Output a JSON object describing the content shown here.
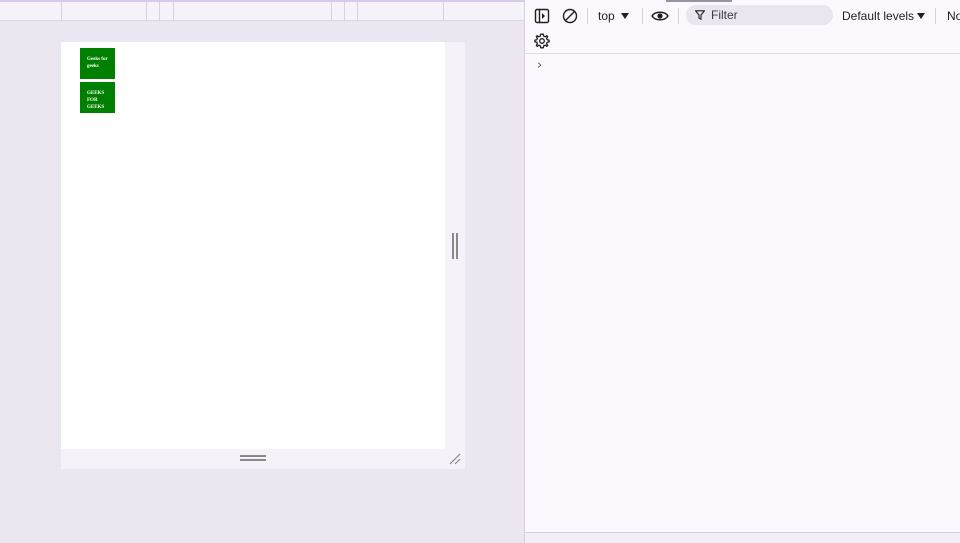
{
  "preview": {
    "box1_text": "Geeks for geeks",
    "box2_text": "GEEKS FOR GEEKS",
    "box_color": "#008000"
  },
  "console": {
    "context_label": "top",
    "filter_placeholder": "Filter",
    "levels_label": "Default levels",
    "issues_label": "No"
  },
  "icons": {
    "sidebar": "sidebar-toggle-icon",
    "clear": "clear-console-icon",
    "eye": "live-expression-icon",
    "filter": "filter-icon",
    "settings": "gear-icon",
    "prompt": "chevron-right-icon"
  }
}
